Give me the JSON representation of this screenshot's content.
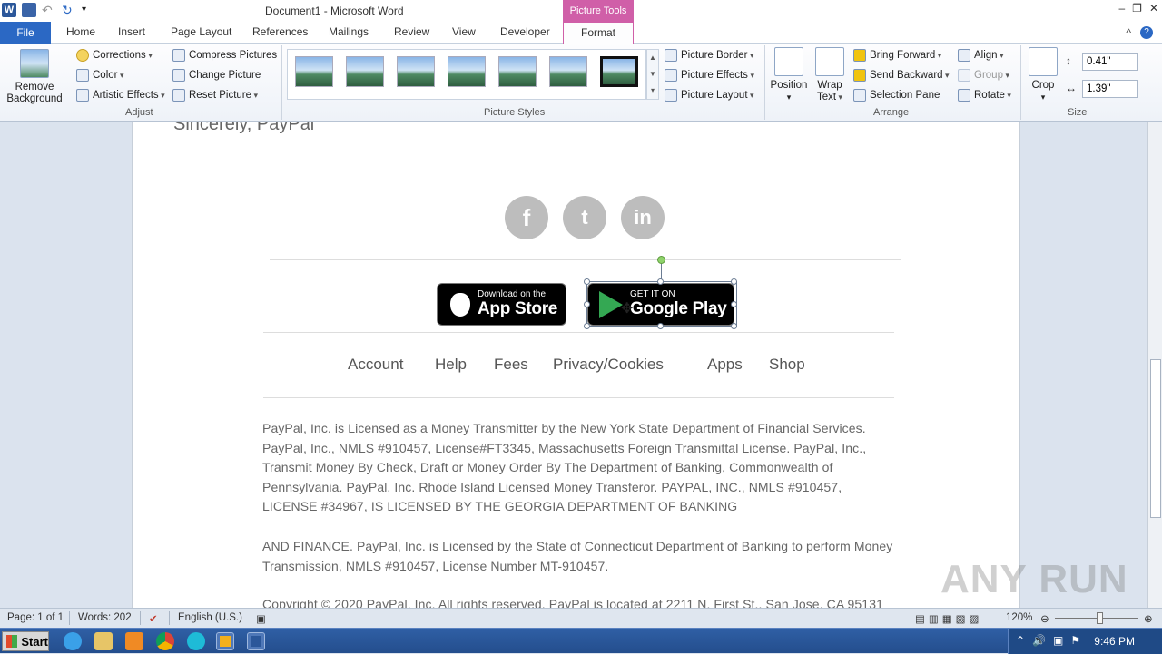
{
  "window": {
    "title": "Document1 - Microsoft Word",
    "context_tab_header": "Picture Tools",
    "controls": [
      "–",
      "❐",
      "✕"
    ]
  },
  "tabs": {
    "file": "File",
    "items": [
      "Home",
      "Insert",
      "Page Layout",
      "References",
      "Mailings",
      "Review",
      "View",
      "Developer"
    ],
    "format": "Format",
    "right_controls": [
      "^",
      "?"
    ]
  },
  "ribbon": {
    "adjust": {
      "label": "Adjust",
      "remove_bg_line1": "Remove",
      "remove_bg_line2": "Background",
      "corrections": "Corrections",
      "color": "Color",
      "artistic": "Artistic Effects",
      "compress": "Compress Pictures",
      "change": "Change Picture",
      "reset": "Reset Picture"
    },
    "picture_styles": {
      "label": "Picture Styles",
      "border": "Picture Border",
      "effects": "Picture Effects",
      "layout": "Picture Layout"
    },
    "arrange": {
      "label": "Arrange",
      "position": "Position",
      "wrap_line1": "Wrap",
      "wrap_line2": "Text",
      "bring_forward": "Bring Forward",
      "send_backward": "Send Backward",
      "selection_pane": "Selection Pane",
      "align": "Align",
      "group": "Group",
      "rotate": "Rotate"
    },
    "size": {
      "label": "Size",
      "crop": "Crop",
      "height": "0.41\"",
      "width": "1.39\""
    }
  },
  "document": {
    "top_cut_text": "Sincerely, PayPal",
    "social": [
      "f",
      "t",
      "in"
    ],
    "appstore": {
      "small": "Download on the",
      "big": "App Store"
    },
    "playstore": {
      "small": "GET IT ON",
      "big": "Google Play"
    },
    "footer_links": [
      "Account",
      "Help",
      "Fees",
      "Privacy/Cookies",
      "Apps",
      "Shop"
    ],
    "legal": {
      "p1_a": "PayPal, Inc. is ",
      "p1_licensed": "Licensed",
      "p1_b": " as a Money  Transmitter by the New York State Department  of Financial Services. PayPal,  Inc., NMLS #910457, License#FT3345,  Massachusetts Foreign Transmittal License. PayPal, Inc., Transmit Money By  Check, Draft or Money  Order By The Department of Banking, Commonwealth  of Pennsylvania.  PayPal, Inc. Rhode Island  Licensed  Money  Transferor. PAYPAL, INC., NMLS #910457, LICENSE #34967, IS LICENSED BY THE  GEORGIA  DEPARTMENT  OF BANKING",
      "p2_a": "AND FINANCE.  PayPal, Inc. is ",
      "p2_licensed": "Licensed",
      "p2_b": " by the State of Connecticut Department of Banking to perform Money  Transmission, NMLS #910457,  License Number MT-910457.",
      "copyright": "Copyright © 2020 PayPal, Inc. All rights reserved. PayPal is located at 2211 N. First St., San Jose, CA 95131"
    }
  },
  "statusbar": {
    "page": "Page: 1 of 1",
    "words": "Words: 202",
    "language": "English (U.S.)",
    "zoom": "120%"
  },
  "taskbar": {
    "start": "Start",
    "clock": "9:46 PM"
  },
  "watermark": "ANY RUN"
}
